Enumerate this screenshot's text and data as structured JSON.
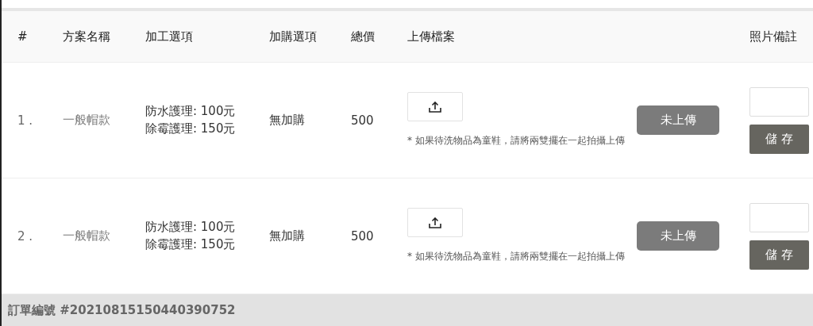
{
  "table": {
    "columns": [
      "#",
      "方案名稱",
      "加工選項",
      "加購選項",
      "總價",
      "上傳檔案",
      "照片備註"
    ],
    "rows": [
      {
        "index": "1 .",
        "plan": "一般帽款",
        "options": [
          "防水護理: 100元",
          "除霉護理: 150元"
        ],
        "addon": "無加購",
        "total": "500",
        "upload_hint": "* 如果待洗物品為童鞋，請將兩雙擺在一起拍攝上傳",
        "status": "未上傳",
        "save": "儲 存"
      },
      {
        "index": "2 .",
        "plan": "一般帽款",
        "options": [
          "防水護理: 100元",
          "除霉護理: 150元"
        ],
        "addon": "無加購",
        "total": "500",
        "upload_hint": "* 如果待洗物品為童鞋，請將兩雙擺在一起拍攝上傳",
        "status": "未上傳",
        "save": "儲 存"
      }
    ]
  },
  "footer": {
    "order_number": "訂單編號 #20210815150440390752"
  }
}
